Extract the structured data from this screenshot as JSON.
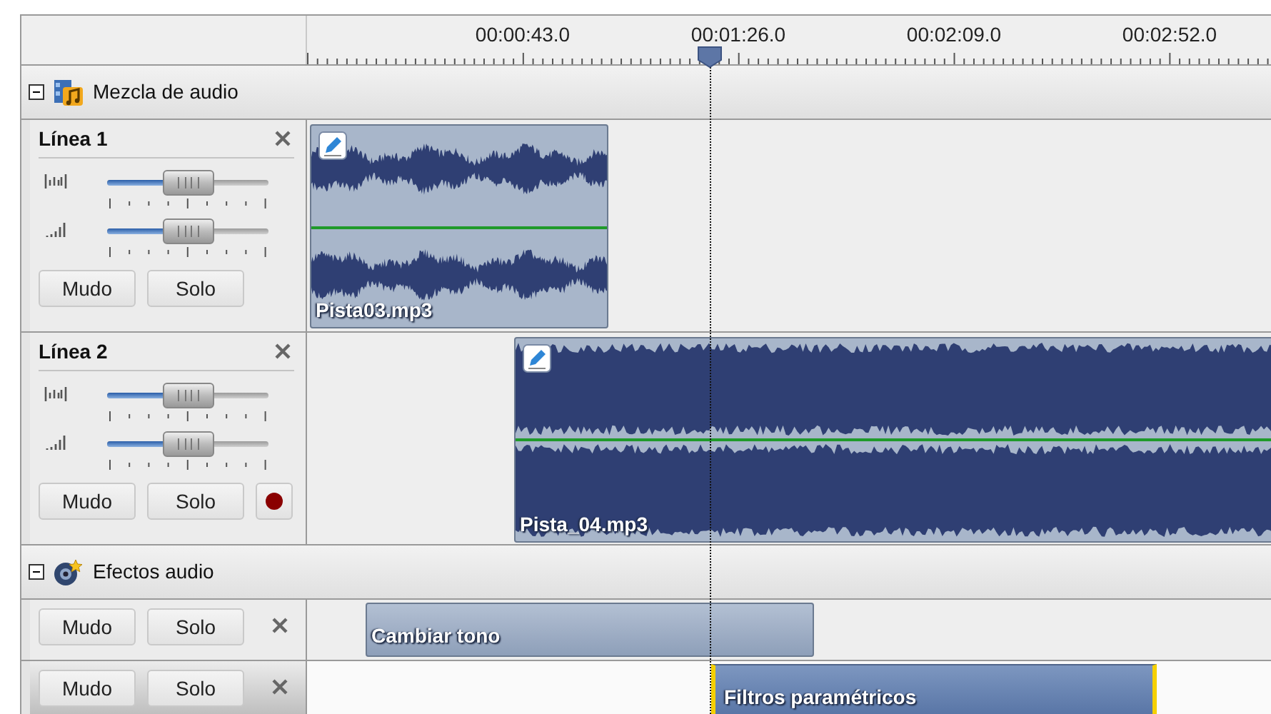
{
  "ruler": {
    "labels": [
      "00:00:43.0",
      "00:01:26.0",
      "00:02:09.0",
      "00:02:52.0"
    ]
  },
  "groups": [
    {
      "title": "Mezcla de audio",
      "kind": "mix",
      "expanded": true,
      "tracks": [
        {
          "kind": "line",
          "name": "Línea 1",
          "sliders": [
            {
              "level": 0.5
            },
            {
              "level": 0.5
            }
          ],
          "buttons": [
            "Mudo",
            "Solo"
          ],
          "record": false,
          "clips": [
            {
              "name": "Pista03.mp3",
              "kind": "sparse",
              "selected": false
            }
          ]
        },
        {
          "kind": "line",
          "name": "Línea 2",
          "sliders": [
            {
              "level": 0.5
            },
            {
              "level": 0.5
            }
          ],
          "buttons": [
            "Mudo",
            "Solo"
          ],
          "record": true,
          "clips": [
            {
              "name": "Pista_04.mp3",
              "kind": "dense",
              "selected": false
            }
          ]
        }
      ]
    },
    {
      "title": "Efectos audio",
      "kind": "effects",
      "expanded": true,
      "tracks": [
        {
          "kind": "effect",
          "selected": false,
          "buttons": [
            "Mudo",
            "Solo"
          ],
          "clips": [
            {
              "name": "Cambiar tono",
              "selected": false
            }
          ]
        },
        {
          "kind": "effect",
          "selected": true,
          "buttons": [
            "Mudo",
            "Solo"
          ],
          "clips": [
            {
              "name": "Filtros paramétricos",
              "selected": true
            }
          ]
        }
      ]
    }
  ]
}
